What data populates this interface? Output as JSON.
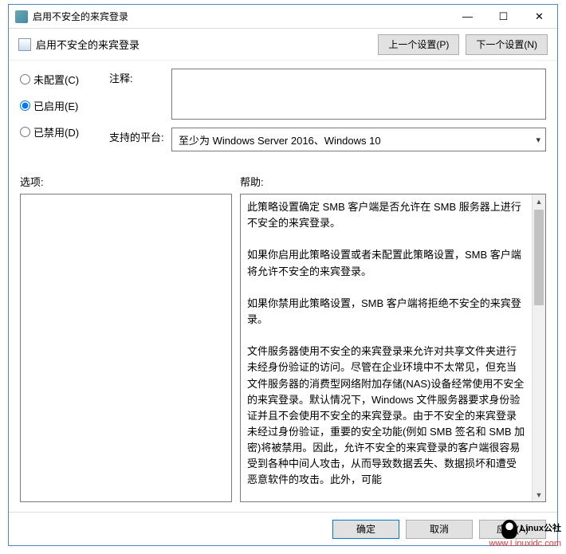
{
  "window": {
    "title": "启用不安全的来宾登录"
  },
  "toolbar": {
    "policy_name": "启用不安全的来宾登录",
    "prev_label": "上一个设置(P)",
    "next_label": "下一个设置(N)"
  },
  "radios": {
    "not_configured": "未配置(C)",
    "enabled": "已启用(E)",
    "disabled": "已禁用(D)",
    "selected": "enabled"
  },
  "fields": {
    "comment_label": "注释:",
    "comment_value": "",
    "platform_label": "支持的平台:",
    "platform_value": "至少为 Windows Server 2016、Windows 10"
  },
  "sections": {
    "options_label": "选项:",
    "help_label": "帮助:"
  },
  "help_text": "此策略设置确定 SMB 客户端是否允许在 SMB 服务器上进行不安全的来宾登录。\n\n如果你启用此策略设置或者未配置此策略设置，SMB 客户端将允许不安全的来宾登录。\n\n如果你禁用此策略设置，SMB 客户端将拒绝不安全的来宾登录。\n\n文件服务器使用不安全的来宾登录来允许对共享文件夹进行未经身份验证的访问。尽管在企业环境中不太常见，但充当文件服务器的消费型网络附加存储(NAS)设备经常使用不安全的来宾登录。默认情况下，Windows 文件服务器要求身份验证并且不会使用不安全的来宾登录。由于不安全的来宾登录未经过身份验证，重要的安全功能(例如 SMB 签名和 SMB 加密)将被禁用。因此，允许不安全的来宾登录的客户端很容易受到各种中间人攻击，从而导致数据丢失、数据损坏和遭受恶意软件的攻击。此外，可能",
  "footer": {
    "ok": "确定",
    "cancel": "取消",
    "apply": "应用(A)"
  },
  "watermark": {
    "brand": "Linux公社",
    "url": "www.Linuxidc.com"
  }
}
